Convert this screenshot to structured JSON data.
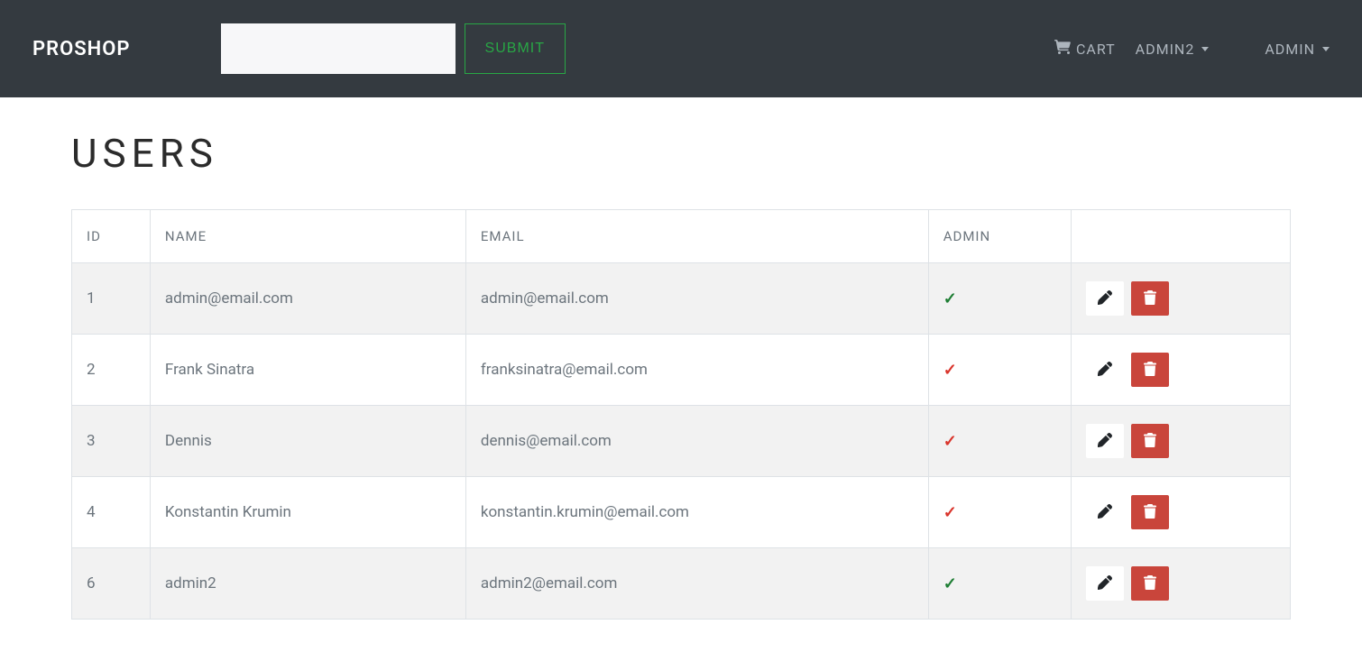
{
  "navbar": {
    "brand": "PROSHOP",
    "search_value": "",
    "search_placeholder": "",
    "submit_label": "SUBMIT",
    "cart_label": "CART",
    "user_dropdown_label": "ADMIN2",
    "admin_dropdown_label": "ADMIN"
  },
  "page": {
    "title": "USERS"
  },
  "table": {
    "headers": {
      "id": "ID",
      "name": "NAME",
      "email": "EMAIL",
      "admin": "ADMIN",
      "actions": ""
    },
    "rows": [
      {
        "id": "1",
        "name": "admin@email.com",
        "email": "admin@email.com",
        "is_admin": true
      },
      {
        "id": "2",
        "name": "Frank Sinatra",
        "email": "franksinatra@email.com",
        "is_admin": false
      },
      {
        "id": "3",
        "name": "Dennis",
        "email": "dennis@email.com",
        "is_admin": false
      },
      {
        "id": "4",
        "name": "Konstantin Krumin",
        "email": "konstantin.krumin@email.com",
        "is_admin": false
      },
      {
        "id": "6",
        "name": "admin2",
        "email": "admin2@email.com",
        "is_admin": true
      }
    ]
  },
  "icons": {
    "check": "✓",
    "cart": "cart-icon",
    "edit": "edit-icon",
    "trash": "trash-icon"
  },
  "colors": {
    "navbar_bg": "#343a40",
    "accent_green": "#28a745",
    "danger": "#c9453b",
    "check_green": "#1e7e34",
    "check_red": "#d9342b"
  }
}
